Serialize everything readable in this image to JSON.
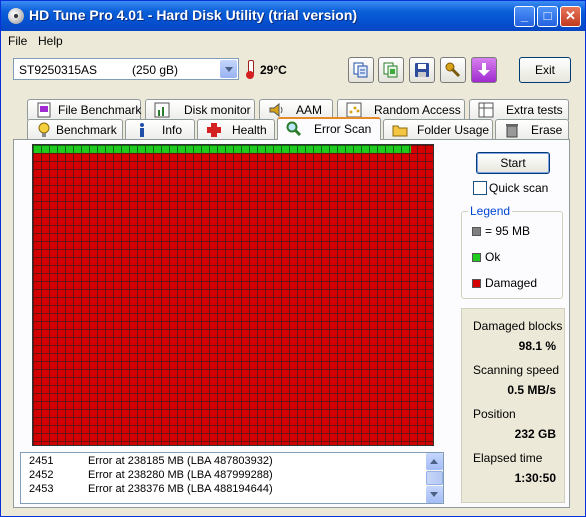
{
  "window": {
    "title": "HD Tune Pro 4.01 - Hard Disk Utility  (trial version)"
  },
  "menu": {
    "file": "File",
    "help": "Help"
  },
  "drive": {
    "name": "ST9250315AS",
    "size": "(250 gB)"
  },
  "temperature": "29°C",
  "toolbar": {
    "exit": "Exit"
  },
  "tabs_top": [
    "File Benchmark",
    "Disk monitor",
    "AAM",
    "Random Access",
    "Extra tests"
  ],
  "tabs_bottom": [
    "Benchmark",
    "Info",
    "Health",
    "Error Scan",
    "Folder Usage",
    "Erase"
  ],
  "scan": {
    "start": "Start",
    "quick_scan": "Quick scan",
    "quick_scan_checked": false,
    "legend_title": "Legend",
    "legend": [
      {
        "label": "= 95 MB",
        "color": "#808080"
      },
      {
        "label": "Ok",
        "color": "#1ecb1e"
      },
      {
        "label": "Damaged",
        "color": "#d40000"
      }
    ],
    "damaged_blocks_label": "Damaged blocks",
    "damaged_blocks": "98.1 %",
    "speed_label": "Scanning speed",
    "speed": "0.5 MB/s",
    "position_label": "Position",
    "position": "232 GB",
    "elapsed_label": "Elapsed time",
    "elapsed": "1:30:50"
  },
  "log": [
    {
      "n": "2451",
      "msg": "Error at 238185 MB (LBA 487803932)"
    },
    {
      "n": "2452",
      "msg": "Error at 238280 MB (LBA 487999288)"
    },
    {
      "n": "2453",
      "msg": "Error at 238376 MB (LBA 488194644)"
    }
  ],
  "colors": {
    "ok": "#1ecb1e",
    "damaged": "#d40000",
    "active_tab_accent": "#e68b2c",
    "title_bar": "#0550d0"
  }
}
